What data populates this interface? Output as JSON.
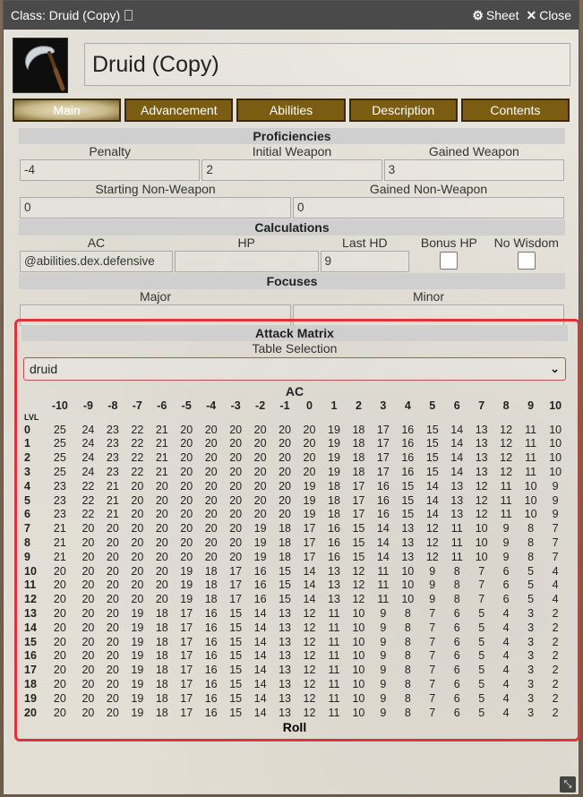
{
  "window": {
    "title": "Class: Druid (Copy)",
    "sheet_label": "Sheet",
    "close_label": "Close"
  },
  "header": {
    "name": "Druid (Copy)"
  },
  "tabs": [
    "Main",
    "Advancement",
    "Abilities",
    "Description",
    "Contents"
  ],
  "proficiencies": {
    "heading": "Proficiencies",
    "labels": [
      "Penalty",
      "Initial Weapon",
      "Gained Weapon"
    ],
    "values": [
      "-4",
      "2",
      "3"
    ],
    "labels2": [
      "Starting Non-Weapon",
      "Gained Non-Weapon"
    ],
    "values2": [
      "0",
      "0"
    ]
  },
  "calculations": {
    "heading": "Calculations",
    "labels": [
      "AC",
      "HP",
      "Last HD",
      "Bonus HP",
      "No Wisdom"
    ],
    "ac": "@abilities.dex.defensive",
    "hp": "",
    "last_hd": "9"
  },
  "focuses": {
    "heading": "Focuses",
    "labels": [
      "Major",
      "Minor"
    ]
  },
  "attack_matrix": {
    "heading": "Attack Matrix",
    "table_selection_label": "Table Selection",
    "selected_table": "druid",
    "ac_label": "AC",
    "lvl_label": "LVL",
    "roll_label": "Roll",
    "ac_columns": [
      "-10",
      "-9",
      "-8",
      "-7",
      "-6",
      "-5",
      "-4",
      "-3",
      "-2",
      "-1",
      "0",
      "1",
      "2",
      "3",
      "4",
      "5",
      "6",
      "7",
      "8",
      "9",
      "10"
    ],
    "rows": [
      {
        "lvl": "0",
        "vals": [
          "25",
          "24",
          "23",
          "22",
          "21",
          "20",
          "20",
          "20",
          "20",
          "20",
          "20",
          "19",
          "18",
          "17",
          "16",
          "15",
          "14",
          "13",
          "12",
          "11",
          "10"
        ]
      },
      {
        "lvl": "1",
        "vals": [
          "25",
          "24",
          "23",
          "22",
          "21",
          "20",
          "20",
          "20",
          "20",
          "20",
          "20",
          "19",
          "18",
          "17",
          "16",
          "15",
          "14",
          "13",
          "12",
          "11",
          "10"
        ]
      },
      {
        "lvl": "2",
        "vals": [
          "25",
          "24",
          "23",
          "22",
          "21",
          "20",
          "20",
          "20",
          "20",
          "20",
          "20",
          "19",
          "18",
          "17",
          "16",
          "15",
          "14",
          "13",
          "12",
          "11",
          "10"
        ]
      },
      {
        "lvl": "3",
        "vals": [
          "25",
          "24",
          "23",
          "22",
          "21",
          "20",
          "20",
          "20",
          "20",
          "20",
          "20",
          "19",
          "18",
          "17",
          "16",
          "15",
          "14",
          "13",
          "12",
          "11",
          "10"
        ]
      },
      {
        "lvl": "4",
        "vals": [
          "23",
          "22",
          "21",
          "20",
          "20",
          "20",
          "20",
          "20",
          "20",
          "20",
          "19",
          "18",
          "17",
          "16",
          "15",
          "14",
          "13",
          "12",
          "11",
          "10",
          "9"
        ]
      },
      {
        "lvl": "5",
        "vals": [
          "23",
          "22",
          "21",
          "20",
          "20",
          "20",
          "20",
          "20",
          "20",
          "20",
          "19",
          "18",
          "17",
          "16",
          "15",
          "14",
          "13",
          "12",
          "11",
          "10",
          "9"
        ]
      },
      {
        "lvl": "6",
        "vals": [
          "23",
          "22",
          "21",
          "20",
          "20",
          "20",
          "20",
          "20",
          "20",
          "20",
          "19",
          "18",
          "17",
          "16",
          "15",
          "14",
          "13",
          "12",
          "11",
          "10",
          "9"
        ]
      },
      {
        "lvl": "7",
        "vals": [
          "21",
          "20",
          "20",
          "20",
          "20",
          "20",
          "20",
          "20",
          "19",
          "18",
          "17",
          "16",
          "15",
          "14",
          "13",
          "12",
          "11",
          "10",
          "9",
          "8",
          "7"
        ]
      },
      {
        "lvl": "8",
        "vals": [
          "21",
          "20",
          "20",
          "20",
          "20",
          "20",
          "20",
          "20",
          "19",
          "18",
          "17",
          "16",
          "15",
          "14",
          "13",
          "12",
          "11",
          "10",
          "9",
          "8",
          "7"
        ]
      },
      {
        "lvl": "9",
        "vals": [
          "21",
          "20",
          "20",
          "20",
          "20",
          "20",
          "20",
          "20",
          "19",
          "18",
          "17",
          "16",
          "15",
          "14",
          "13",
          "12",
          "11",
          "10",
          "9",
          "8",
          "7"
        ]
      },
      {
        "lvl": "10",
        "vals": [
          "20",
          "20",
          "20",
          "20",
          "20",
          "19",
          "18",
          "17",
          "16",
          "15",
          "14",
          "13",
          "12",
          "11",
          "10",
          "9",
          "8",
          "7",
          "6",
          "5",
          "4"
        ]
      },
      {
        "lvl": "11",
        "vals": [
          "20",
          "20",
          "20",
          "20",
          "20",
          "19",
          "18",
          "17",
          "16",
          "15",
          "14",
          "13",
          "12",
          "11",
          "10",
          "9",
          "8",
          "7",
          "6",
          "5",
          "4"
        ]
      },
      {
        "lvl": "12",
        "vals": [
          "20",
          "20",
          "20",
          "20",
          "20",
          "19",
          "18",
          "17",
          "16",
          "15",
          "14",
          "13",
          "12",
          "11",
          "10",
          "9",
          "8",
          "7",
          "6",
          "5",
          "4"
        ]
      },
      {
        "lvl": "13",
        "vals": [
          "20",
          "20",
          "20",
          "19",
          "18",
          "17",
          "16",
          "15",
          "14",
          "13",
          "12",
          "11",
          "10",
          "9",
          "8",
          "7",
          "6",
          "5",
          "4",
          "3",
          "2"
        ]
      },
      {
        "lvl": "14",
        "vals": [
          "20",
          "20",
          "20",
          "19",
          "18",
          "17",
          "16",
          "15",
          "14",
          "13",
          "12",
          "11",
          "10",
          "9",
          "8",
          "7",
          "6",
          "5",
          "4",
          "3",
          "2"
        ]
      },
      {
        "lvl": "15",
        "vals": [
          "20",
          "20",
          "20",
          "19",
          "18",
          "17",
          "16",
          "15",
          "14",
          "13",
          "12",
          "11",
          "10",
          "9",
          "8",
          "7",
          "6",
          "5",
          "4",
          "3",
          "2"
        ]
      },
      {
        "lvl": "16",
        "vals": [
          "20",
          "20",
          "20",
          "19",
          "18",
          "17",
          "16",
          "15",
          "14",
          "13",
          "12",
          "11",
          "10",
          "9",
          "8",
          "7",
          "6",
          "5",
          "4",
          "3",
          "2"
        ]
      },
      {
        "lvl": "17",
        "vals": [
          "20",
          "20",
          "20",
          "19",
          "18",
          "17",
          "16",
          "15",
          "14",
          "13",
          "12",
          "11",
          "10",
          "9",
          "8",
          "7",
          "6",
          "5",
          "4",
          "3",
          "2"
        ]
      },
      {
        "lvl": "18",
        "vals": [
          "20",
          "20",
          "20",
          "19",
          "18",
          "17",
          "16",
          "15",
          "14",
          "13",
          "12",
          "11",
          "10",
          "9",
          "8",
          "7",
          "6",
          "5",
          "4",
          "3",
          "2"
        ]
      },
      {
        "lvl": "19",
        "vals": [
          "20",
          "20",
          "20",
          "19",
          "18",
          "17",
          "16",
          "15",
          "14",
          "13",
          "12",
          "11",
          "10",
          "9",
          "8",
          "7",
          "6",
          "5",
          "4",
          "3",
          "2"
        ]
      },
      {
        "lvl": "20",
        "vals": [
          "20",
          "20",
          "20",
          "19",
          "18",
          "17",
          "16",
          "15",
          "14",
          "13",
          "12",
          "11",
          "10",
          "9",
          "8",
          "7",
          "6",
          "5",
          "4",
          "3",
          "2"
        ]
      }
    ]
  },
  "colors": {
    "tab": "#7a5d13",
    "highlight": "#e0323a",
    "titlebar": "#4a4a4a"
  },
  "icons": [
    "doc-icon",
    "gear-icon",
    "close-icon",
    "sickle-icon",
    "resize-icon",
    "chevron-down-icon"
  ]
}
